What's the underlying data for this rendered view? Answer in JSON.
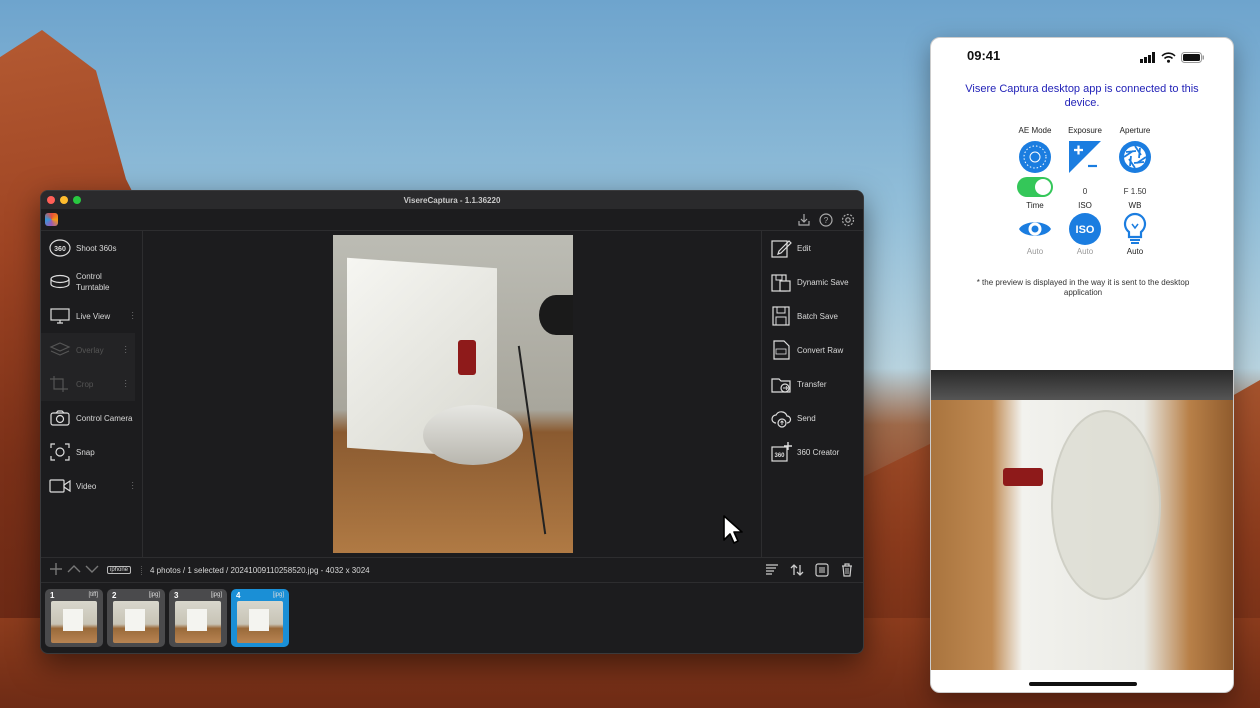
{
  "app": {
    "title": "VisereCaptura - 1.1.36220",
    "left_menu": [
      {
        "label": "Shoot 360s",
        "icon": "360-icon"
      },
      {
        "label": "Control Turntable",
        "icon": "turntable-icon"
      },
      {
        "label": "Live View",
        "icon": "monitor-icon"
      },
      {
        "label": "Overlay",
        "icon": "layers-icon"
      },
      {
        "label": "Crop",
        "icon": "crop-icon"
      },
      {
        "label": "Control Camera",
        "icon": "camera-icon"
      },
      {
        "label": "Snap",
        "icon": "snap-icon"
      },
      {
        "label": "Video",
        "icon": "video-icon"
      }
    ],
    "right_menu": [
      {
        "label": "Edit",
        "icon": "edit-icon"
      },
      {
        "label": "Dynamic Save",
        "icon": "dynamic-save-icon"
      },
      {
        "label": "Batch Save",
        "icon": "batch-save-icon"
      },
      {
        "label": "Convert Raw",
        "icon": "convert-raw-icon"
      },
      {
        "label": "Transfer",
        "icon": "transfer-icon"
      },
      {
        "label": "Send",
        "icon": "send-icon"
      },
      {
        "label": "360 Creator",
        "icon": "360-creator-icon"
      }
    ],
    "bottom": {
      "iphone_label": "iphone",
      "info": "4 photos / 1 selected / 20241009110258520.jpg - 4032 x 3024"
    },
    "thumbnails": [
      {
        "num": "1",
        "ext": "[tiff]"
      },
      {
        "num": "2",
        "ext": "[jpg]"
      },
      {
        "num": "3",
        "ext": "[jpg]"
      },
      {
        "num": "4",
        "ext": "[jpg]"
      }
    ]
  },
  "phone": {
    "time": "09:41",
    "connection_message": "Visere Captura desktop app is connected to this device.",
    "headers_row1": [
      "AE Mode",
      "Exposure",
      "Aperture"
    ],
    "values_row1": [
      "",
      "0",
      "F 1.50"
    ],
    "headers_row2": [
      "Time",
      "ISO",
      "WB"
    ],
    "values_row2": [
      "Auto",
      "Auto",
      "Auto"
    ],
    "preview_note": "* the preview is displayed in the way it is sent to the desktop application"
  },
  "colors": {
    "accent_blue": "#1a8fd6",
    "phone_icon_blue": "#1b7de0",
    "toggle_green": "#34c759",
    "connection_text": "#2323b8"
  }
}
